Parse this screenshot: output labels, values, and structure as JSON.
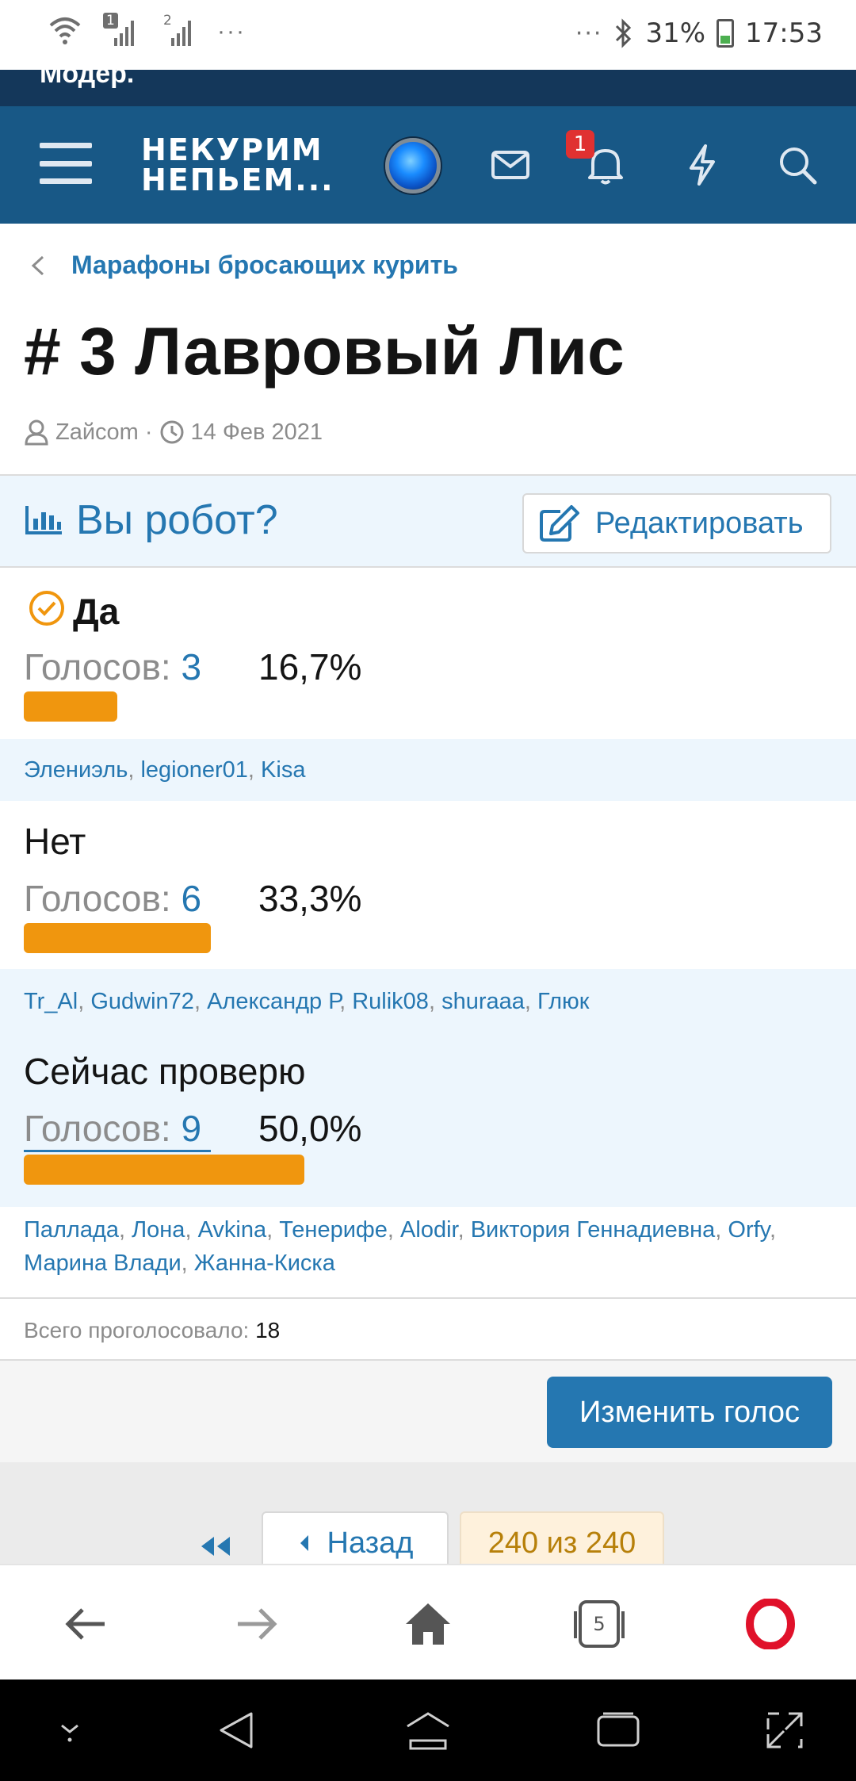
{
  "status_bar": {
    "dots_left": "···",
    "sim1": "1",
    "sim2": "2",
    "dots_right": "···",
    "battery": "31%",
    "time": "17:53"
  },
  "top_strip_text": "Модер.",
  "header": {
    "logo_line1": "НЕКУРИМ",
    "logo_line2": "НЕПЬЕМ...",
    "notification_count": "1"
  },
  "breadcrumb": "Марафоны бросающих курить",
  "thread": {
    "title": "# 3 Лавровый Лис",
    "author": "Zайсom",
    "separator": "·",
    "date": "14 Фев 2021"
  },
  "poll": {
    "question": "Вы робот?",
    "edit_label": "Редактировать",
    "votes_label": "Голосов:",
    "options": [
      {
        "name": "Да",
        "votes": "3",
        "percent": "16,7%",
        "fraction": 0.167,
        "voters": [
          "Элениэль",
          "legioner01",
          "Kisa"
        ]
      },
      {
        "name": "Нет",
        "votes": "6",
        "percent": "33,3%",
        "fraction": 0.333,
        "voters": [
          "Tr_Al",
          "Gudwin72",
          "Александр Р",
          "Rulik08",
          "shuraaa",
          "Глюк"
        ]
      },
      {
        "name": "Сейчас проверю",
        "votes": "9",
        "percent": "50,0%",
        "fraction": 0.5,
        "voters": [
          "Паллада",
          "Лона",
          "Avkina",
          "Тенерифе",
          "Alodir",
          "Виктория Геннадиевна",
          "Orfy",
          "Марина Влади",
          "Жанна-Киска"
        ]
      }
    ],
    "total_label": "Всего проголосовало:",
    "total_value": "18",
    "change_vote_label": "Изменить голос"
  },
  "pagination": {
    "back_label": "Назад",
    "current": "240 из 240"
  },
  "browser": {
    "tabs_count": "5"
  },
  "colors": {
    "header_bg": "#185886",
    "top_strip_bg": "#14375a",
    "link": "#2577b1",
    "bar": "#f0960e",
    "voters_bg": "#edf6fd"
  }
}
